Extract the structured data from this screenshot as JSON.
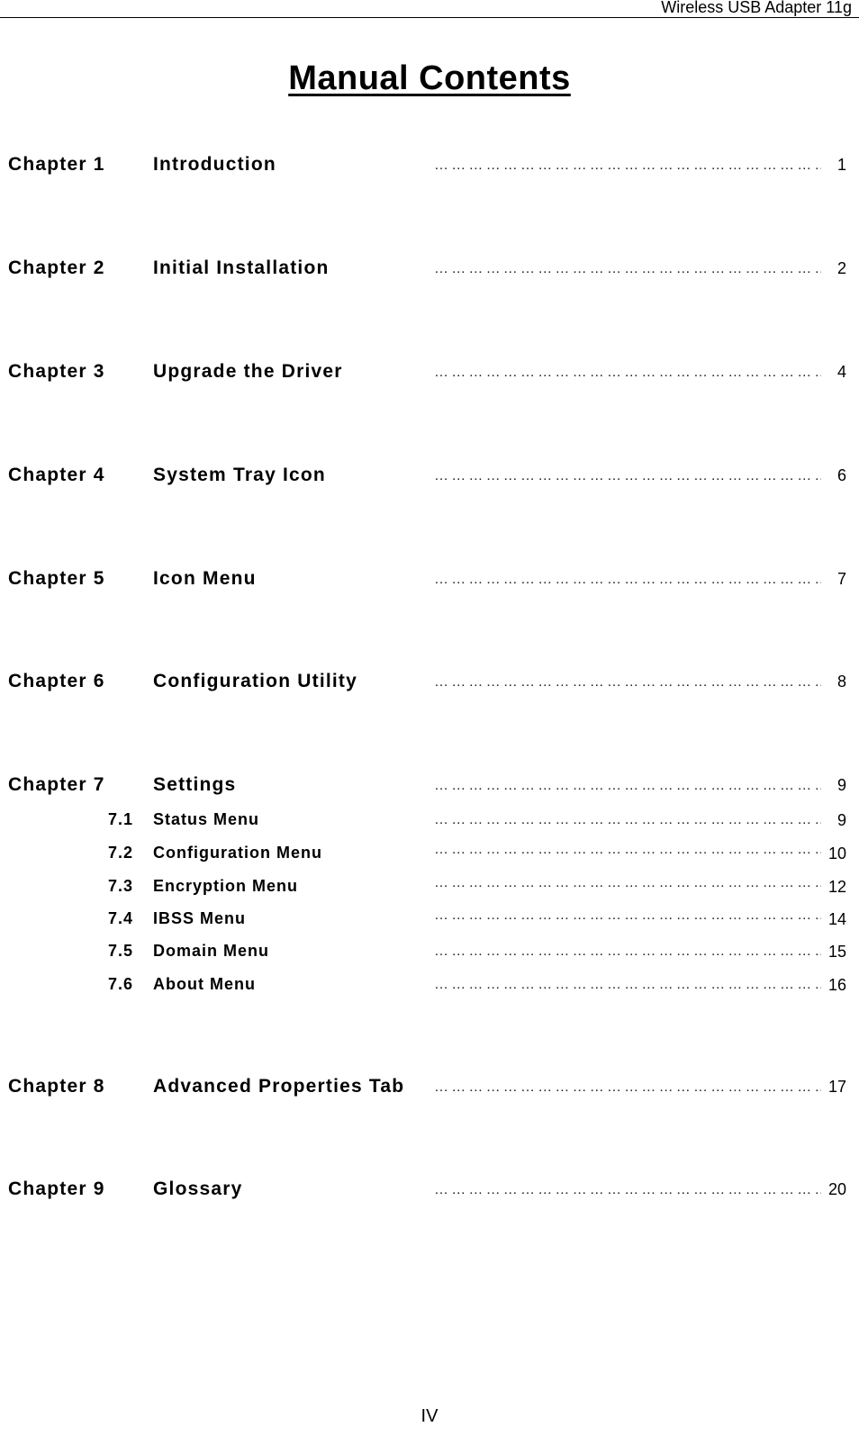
{
  "header": {
    "title": "Wireless USB Adapter 11g"
  },
  "page_title": "Manual Contents",
  "leader": "……………………………………………………………………………",
  "toc": {
    "chapters": [
      {
        "label": "Chapter  1",
        "title": "Introduction",
        "page": "1"
      },
      {
        "label": "Chapter  2",
        "title": "Initial Installation",
        "page": "2"
      },
      {
        "label": "Chapter  3",
        "title": "Upgrade the Driver",
        "page": "4"
      },
      {
        "label": "Chapter  4",
        "title": "System Tray Icon",
        "page": "6"
      },
      {
        "label": "Chapter  5",
        "title": "Icon Menu",
        "page": "7"
      },
      {
        "label": "Chapter  6",
        "title": "Configuration Utility",
        "page": "8"
      },
      {
        "label": "Chapter  7",
        "title": "Settings",
        "page": "9"
      },
      {
        "label": "Chapter  8",
        "title": "Advanced Properties Tab",
        "page": "17"
      },
      {
        "label": "Chapter  9",
        "title": "Glossary",
        "page": "20"
      }
    ],
    "sections": [
      {
        "num": "7.1",
        "title": "Status Menu",
        "page": "9"
      },
      {
        "num": "7.2",
        "title": "Configuration Menu",
        "page": "10"
      },
      {
        "num": "7.3",
        "title": "Encryption Menu",
        "page": "12"
      },
      {
        "num": "7.4",
        "title": "IBSS Menu",
        "page": "14"
      },
      {
        "num": "7.5",
        "title": "Domain Menu",
        "page": "15"
      },
      {
        "num": "7.6",
        "title": "About Menu",
        "page": "16"
      }
    ]
  },
  "footer": {
    "page_number": "IV"
  }
}
